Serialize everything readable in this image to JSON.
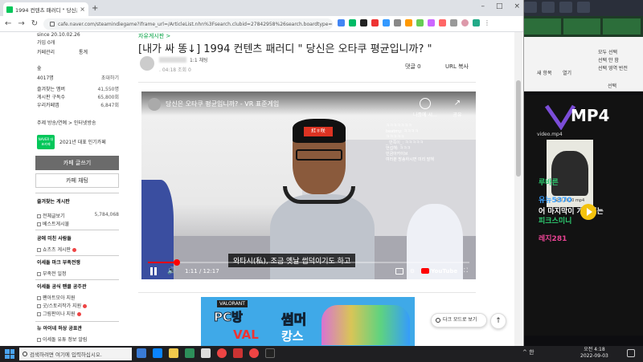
{
  "browser": {
    "tab_title": "1994 컨텐츠 패러디 \" 당신은 ...",
    "url": "cafe.naver.com/steamindiegame?iframe_url=/ArticleList.nhn%3Fsearch.clubid=27842958%26search.boardtype=L",
    "new_tab": "+",
    "close": "×"
  },
  "sidebar": {
    "top_date": "since 20.10.02.26",
    "top_sub": "가입 0개",
    "cafe_info": "카페관리",
    "stats_label": "통계",
    "member_icon_label": "숲",
    "members_label": "4017명",
    "invite_label": "초대하기",
    "rows": [
      {
        "label": "즐겨찾는 멤버",
        "value": "41,550명"
      },
      {
        "label": "게시판 구독수",
        "value": "65,800회"
      },
      {
        "label": "우리카페앱",
        "value": "6,847회"
      }
    ],
    "notice": "주제 방송/연예 > 인터넷방송",
    "naver_badge": "NAVER 대표카페",
    "award": "2021년 대표 인기카페",
    "write_button": "카페 글쓰기",
    "chat_button": "카페 채팅",
    "fav_head": "즐겨찾는 게시판",
    "all_posts": "전체글보기",
    "all_posts_count": "5,784,068",
    "best_posts": "베스트게시물",
    "section2_head": "공에 미친 사람들",
    "section2_item": "쇼츠츠 게시판",
    "section3_head": "이세돌 마크 부족전쟁",
    "section3_item": "부족전 일정",
    "section4_head": "이세돌 공식 팬클 공주관",
    "section4_items": [
      "팬아트모아 지원",
      "굿/스토리작가 지원",
      "그림판이나 지원"
    ],
    "section5_head": "뉴 아이네 허상 공표관",
    "section5_item": "이세돌 유튜 정보 알림"
  },
  "article": {
    "board_link": "자유게시판 >",
    "title": "[내가 싸 똥↓] 1994 컨텐츠 패러디 \" 당신은 오타쿠 평균입니까? \"",
    "author_grade": "1:1 채팅",
    "date": ". 04:18 조회 0",
    "comments": "댓글 0",
    "copy_url": "URL 복사"
  },
  "video": {
    "title": "당신은 오타쿠 평균입니까? - VR 표준게임",
    "headband": "紅ㅎ咲",
    "watch_later": "나중에 시...",
    "share": "공유",
    "chat_lines": [
      "ㅋㅋㅋㅋㅋㅋㅋ",
      "beatmy: ㅋㅋㅋㅋ",
      "ㅋㅋㅋㅋㅋ",
      "_ 반쪽이_: ㅋㅋㅋㅋㅋ",
      "언섭해: ㅋㅋㅋ",
      "민금아카이브",
      "여러분 방송하시면 미리 말해"
    ],
    "subtitle": "와타시(私), 조금 옛날 썹덕이기도 하고",
    "time": "1:11 / 12:17",
    "progress": 0.09,
    "youtube": "YouTube"
  },
  "ad": {
    "brand": "VALORANT",
    "line1": "PC방",
    "line2": "썸머",
    "line3": "VAL",
    "line4": "캉스"
  },
  "floating": {
    "darkmode": "다크 모드로 보기",
    "top": "↑"
  },
  "desktop": {
    "mp4_text": "MP4",
    "file_name": "video.mp4",
    "thumb_label": "요뒤 2020 mp4",
    "chat": [
      {
        "text": "루바른",
        "color": "#2ecc71"
      },
      {
        "text": "유뉴5370",
        "color": "#3aa0ff"
      },
      {
        "text": "어 마지막이 개웃기는",
        "color": "#ffffff"
      },
      {
        "text": "피크스미니",
        "color": "#2ecc71"
      },
      {
        "text": "레지281",
        "color": "#e84393"
      }
    ],
    "explorer_items": [
      "새 항목",
      "열기",
      "선택",
      "모두 선택",
      "선택 안 함",
      "선택 영역 반전"
    ]
  },
  "taskbar": {
    "search_placeholder": "검색하려면 여기에 입력하십시오.",
    "time": "오전 4:18",
    "date": "2022-09-03",
    "tray": "^ 한"
  }
}
